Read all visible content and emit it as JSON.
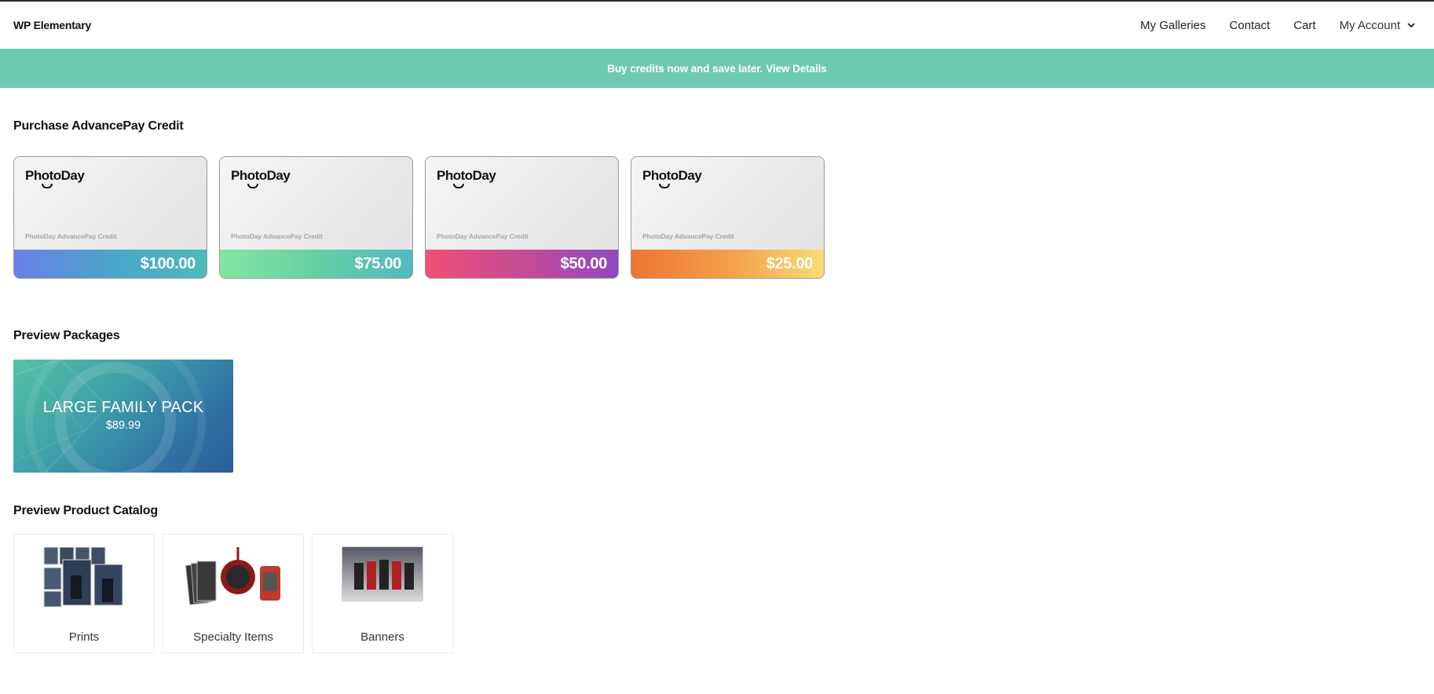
{
  "header": {
    "brand": "WP Elementary",
    "nav": [
      "My Galleries",
      "Contact",
      "Cart",
      "My Account"
    ]
  },
  "banner": {
    "text": "Buy credits now and save later.",
    "link": "View Details",
    "color": "#6ec9b1"
  },
  "credit": {
    "title": "Purchase AdvancePay Credit",
    "logo": "PhotoDay",
    "caption": "PhotoDay AdvancePay Credit",
    "cards": [
      {
        "amount": "$100.00"
      },
      {
        "amount": "$75.00"
      },
      {
        "amount": "$50.00"
      },
      {
        "amount": "$25.00"
      }
    ]
  },
  "packages": {
    "title": "Preview Packages",
    "items": [
      {
        "name": "LARGE FAMILY PACK",
        "price": "$89.99"
      }
    ]
  },
  "catalog": {
    "title": "Preview Product Catalog",
    "items": [
      {
        "label": "Prints",
        "icon": "prints-thumbnail"
      },
      {
        "label": "Specialty Items",
        "icon": "specialty-items-thumbnail"
      },
      {
        "label": "Banners",
        "icon": "banners-thumbnail"
      }
    ]
  }
}
